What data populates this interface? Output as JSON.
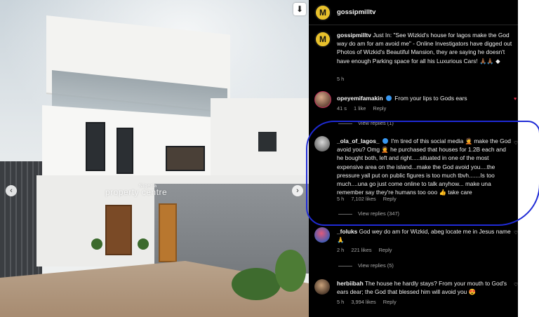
{
  "photo": {
    "watermark_small": "Nigeria",
    "watermark": "property centre",
    "download_icon": "download-icon",
    "prev_icon": "chevron-left-icon",
    "next_icon": "chevron-right-icon"
  },
  "post": {
    "username": "gossipmilltv",
    "avatar_letter": "M",
    "caption_username": "gossipmilltv",
    "caption": "Just In: \"See Wizkid's house for lagos make the God way do am for am avoid me\" - Online Investigators have digged out Photos of Wizkid's Beautiful Mansion, they are saying he doesn't have enough Parking space for all his Luxurious Cars! 🙏🏾🙏🏾 ◆",
    "caption_time": "5 h"
  },
  "comments": [
    {
      "username": "opeyemifamakin",
      "verified": true,
      "text": "From your lips to Gods ears",
      "time": "41 s",
      "likes": "1 like",
      "reply": "Reply",
      "view_replies": "View replies (1)",
      "liked": true
    },
    {
      "username": "_ola_of_lagos_",
      "verified": true,
      "text": "I'm tired of this social media 🤦 make the God avoid you? Omg 🤦 he purchased that houses for 1.2B each and he bought both, left and right.....situated in one of the most expensive area on the island...make the God avoid you....the pressure yall put on public figures is too much tbvh.......Is too much....una go just come online to talk anyhow... make una remember say they're humans too ooo 👍 take care",
      "time": "5 h",
      "likes": "7,102 likes",
      "reply": "Reply",
      "view_replies": "View replies (347)",
      "liked": false
    },
    {
      "username": "_foluks",
      "verified": false,
      "text": "God wey do am for Wizkid, abeg locate me in Jesus name 🙏",
      "time": "2 h",
      "likes": "221 likes",
      "reply": "Reply",
      "view_replies": "View replies (5)",
      "liked": false
    },
    {
      "username": "herbiibah",
      "verified": false,
      "text": "The house he hardly stays? From your mouth to God's ears dear; the God that blessed him will avoid you 😍",
      "time": "5 h",
      "likes": "3,994 likes",
      "reply": "Reply",
      "liked": false
    }
  ],
  "colors": {
    "panel_bg": "#000000",
    "meta_text": "#a8a8a8",
    "verified_badge": "#3897f0",
    "highlight_outline": "#1f2bd6",
    "like_red": "#e0304a"
  }
}
